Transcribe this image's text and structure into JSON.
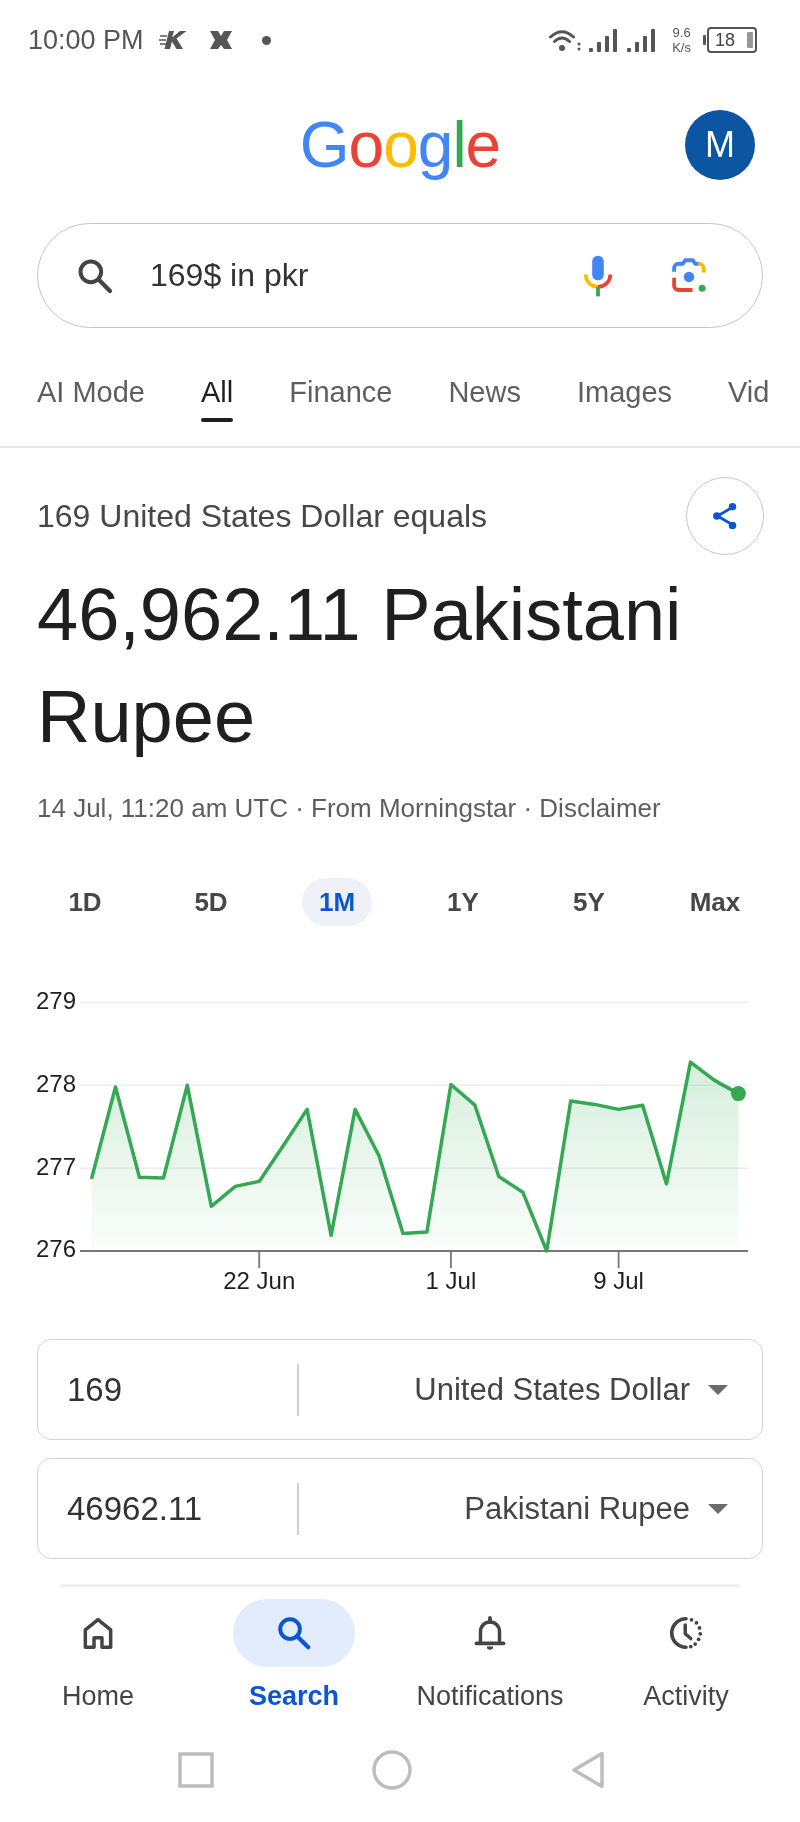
{
  "status_bar": {
    "time": "10:00 PM",
    "net_speed": "9.6",
    "net_speed_unit": "K/s",
    "battery": "18"
  },
  "header": {
    "logo": "Google",
    "avatar": "M"
  },
  "search": {
    "value": "169$ in pkr"
  },
  "tabs": [
    {
      "label": "AI Mode",
      "selected": false
    },
    {
      "label": "All",
      "selected": true
    },
    {
      "label": "Finance",
      "selected": false
    },
    {
      "label": "News",
      "selected": false
    },
    {
      "label": "Images",
      "selected": false
    },
    {
      "label": "Vid",
      "selected": false
    }
  ],
  "result": {
    "caption": "169 United States Dollar equals",
    "amount": "46,962.11 Pakistani Rupee",
    "meta": "14 Jul, 11:20 am UTC · From Morningstar · Disclaimer"
  },
  "ranges": [
    {
      "label": "1D",
      "selected": false
    },
    {
      "label": "5D",
      "selected": false
    },
    {
      "label": "1M",
      "selected": true
    },
    {
      "label": "1Y",
      "selected": false
    },
    {
      "label": "5Y",
      "selected": false
    },
    {
      "label": "Max",
      "selected": false
    }
  ],
  "chart": {
    "chart_data": {
      "type": "area",
      "categories": [
        null,
        null,
        null,
        null,
        null,
        null,
        null,
        "22 Jun",
        null,
        null,
        null,
        null,
        null,
        null,
        null,
        "1 Jul",
        null,
        null,
        null,
        null,
        null,
        null,
        "9 Jul",
        null,
        null,
        null,
        null,
        null
      ],
      "series": [
        {
          "color": "#34a853",
          "values": [
            276.87,
            277.98,
            276.89,
            276.88,
            278.0,
            276.54,
            276.78,
            276.84,
            277.27,
            277.71,
            276.19,
            277.71,
            277.15,
            276.21,
            276.23,
            278.01,
            277.76,
            276.9,
            276.71,
            276.0,
            277.81,
            277.77,
            277.71,
            277.76,
            276.81,
            278.28,
            278.06,
            277.9
          ]
        }
      ],
      "ylim": [
        276,
        279
      ],
      "yticks": [
        276,
        277,
        278,
        279
      ]
    }
  },
  "converter": [
    {
      "value": "169",
      "currency": "United States Dollar"
    },
    {
      "value": "46962.11",
      "currency": "Pakistani Rupee"
    }
  ],
  "bottom_nav": [
    {
      "kind": "home",
      "label": "Home",
      "selected": false
    },
    {
      "kind": "search",
      "label": "Search",
      "selected": true
    },
    {
      "kind": "bell",
      "label": "Notifications",
      "selected": false
    },
    {
      "kind": "activity",
      "label": "Activity",
      "selected": false
    }
  ]
}
